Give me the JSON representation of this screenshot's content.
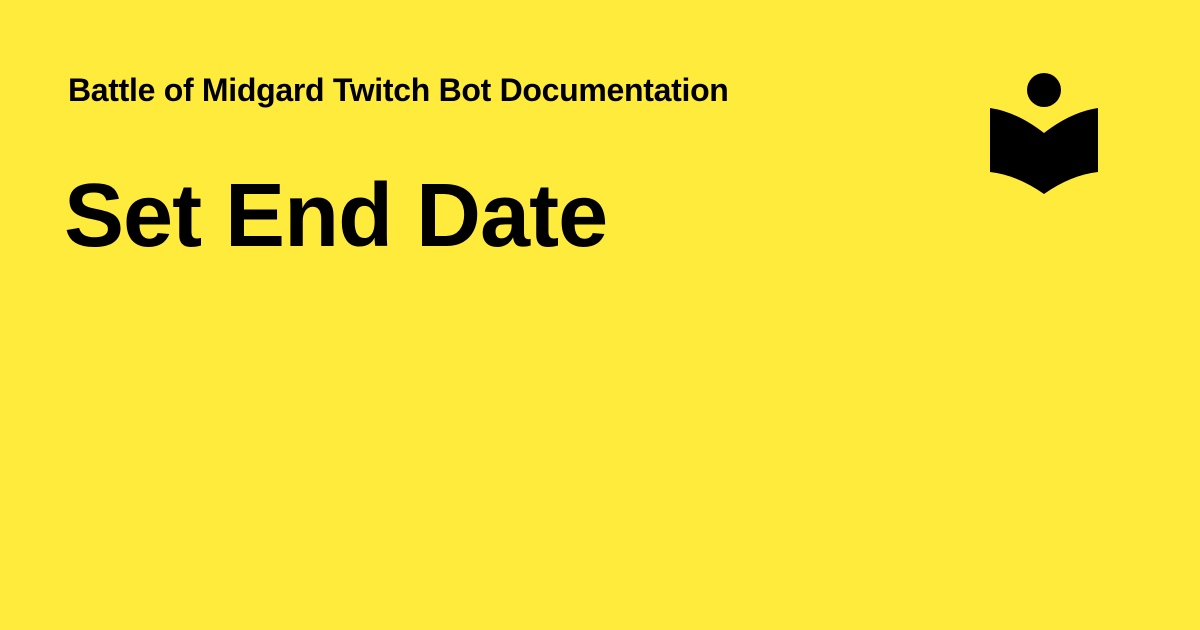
{
  "header": {
    "site_name": "Battle of Midgard Twitch Bot Documentation"
  },
  "main": {
    "page_title": "Set End Date"
  },
  "logo": {
    "icon": "reading-person-book-icon"
  },
  "colors": {
    "background": "#FFEB3B",
    "text": "#000000"
  }
}
